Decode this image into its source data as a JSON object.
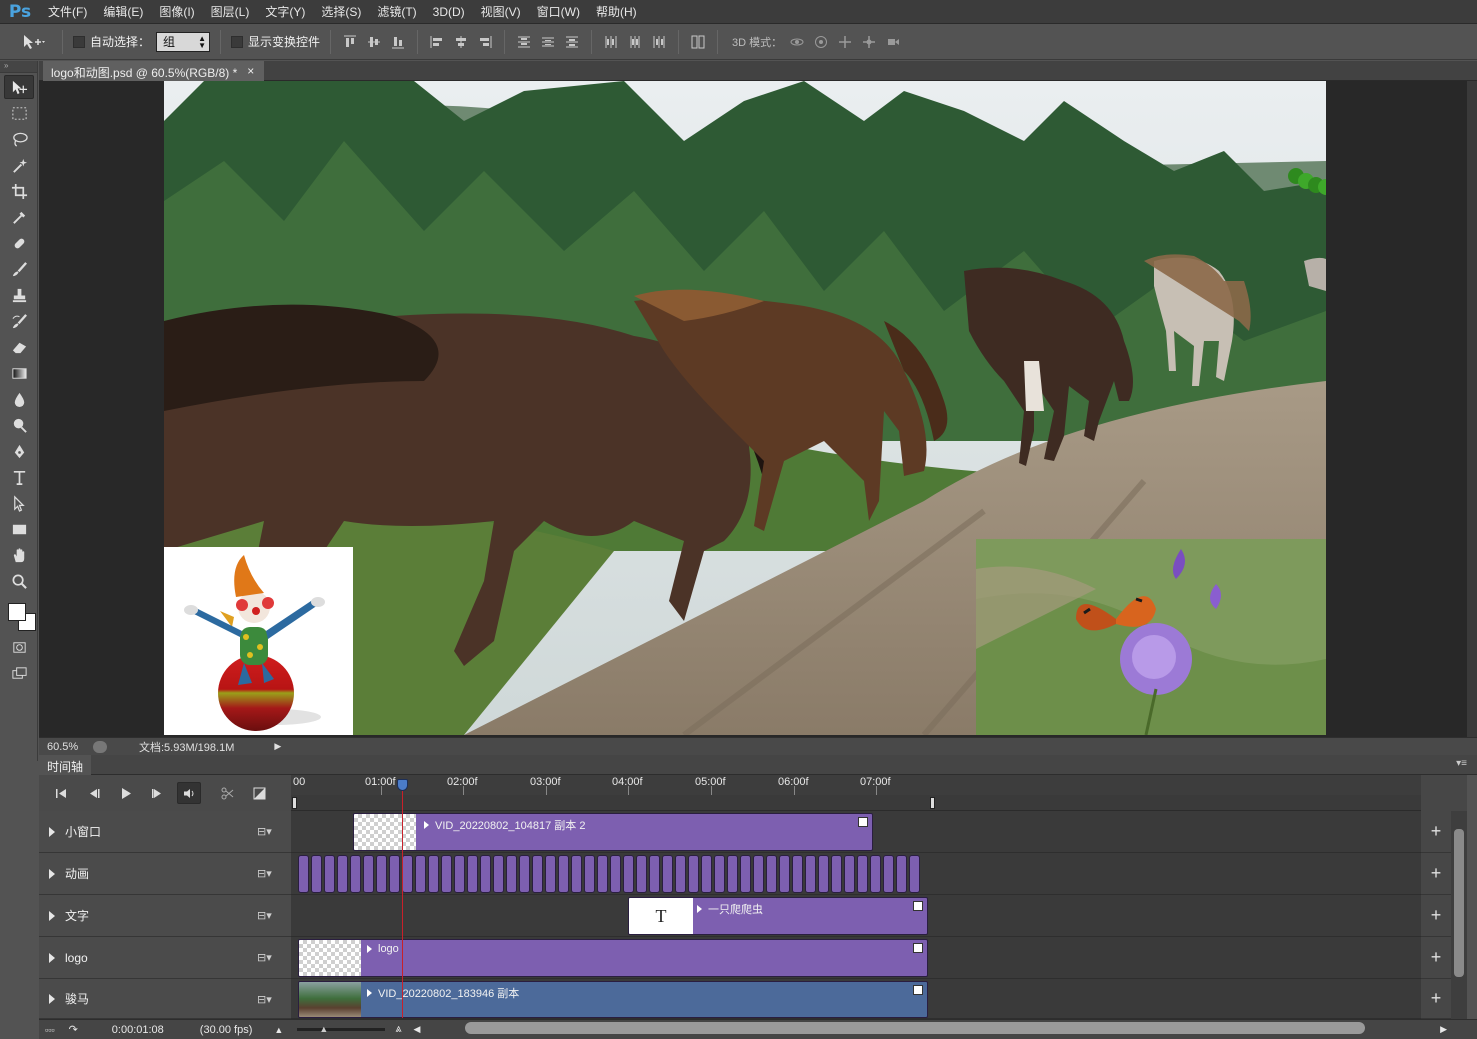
{
  "app": {
    "logo": "Ps"
  },
  "menu": [
    "文件(F)",
    "编辑(E)",
    "图像(I)",
    "图层(L)",
    "文字(Y)",
    "选择(S)",
    "滤镜(T)",
    "3D(D)",
    "视图(V)",
    "窗口(W)",
    "帮助(H)"
  ],
  "options": {
    "auto_select_label": "自动选择：",
    "auto_select_value": "组",
    "show_transform_label": "显示变换控件",
    "mode3d_label": "3D 模式："
  },
  "document": {
    "tab_title": "logo和动图.psd @ 60.5%(RGB/8) *",
    "close": "×"
  },
  "status": {
    "zoom": "60.5%",
    "doc_info": "文档:5.93M/198.1M"
  },
  "timeline": {
    "title": "时间轴",
    "ruler_labels": [
      "00",
      "01:00f",
      "02:00f",
      "03:00f",
      "04:00f",
      "05:00f",
      "06:00f",
      "07:00f"
    ],
    "tracks": [
      {
        "name": "小窗口",
        "clip": "VID_20220802_104817 副本 2"
      },
      {
        "name": "动画",
        "clip": ""
      },
      {
        "name": "文字",
        "clip": "一只爬爬虫",
        "thumb_text": "T"
      },
      {
        "name": "logo",
        "clip": "logo"
      },
      {
        "name": "骏马",
        "clip": "VID_20220802_183946 副本"
      }
    ],
    "current_time": "0:00:01:08",
    "fps": "(30.00 fps)"
  },
  "colors": {
    "clip_purple": "#7d5fb0",
    "clip_blue": "#4c6a9a",
    "playhead": "#c8202a"
  }
}
